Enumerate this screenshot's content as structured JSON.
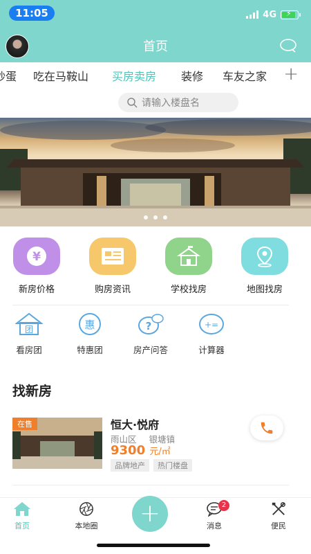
{
  "status": {
    "time": "11:05",
    "network": "4G"
  },
  "header": {
    "title": "首页"
  },
  "tabs": [
    {
      "label": "炒蛋",
      "active": false
    },
    {
      "label": "吃在马鞍山",
      "active": false
    },
    {
      "label": "买房卖房",
      "active": true
    },
    {
      "label": "装修",
      "active": false
    },
    {
      "label": "车友之家",
      "active": false
    }
  ],
  "search": {
    "placeholder": "请输入楼盘名"
  },
  "quick_actions": [
    {
      "label": "新房价格",
      "icon": "yen-icon",
      "color": "#c08fe8"
    },
    {
      "label": "购房资讯",
      "icon": "news-icon",
      "color": "#f6c76b"
    },
    {
      "label": "学校找房",
      "icon": "school-icon",
      "color": "#8fd48a"
    },
    {
      "label": "地图找房",
      "icon": "map-pin-icon",
      "color": "#7fdde0"
    }
  ],
  "sub_actions": [
    {
      "label": "看房团",
      "icon": "group-house-icon",
      "glyph": "团"
    },
    {
      "label": "特惠团",
      "icon": "discount-icon",
      "glyph": "惠"
    },
    {
      "label": "房产问答",
      "icon": "question-icon",
      "glyph": "?"
    },
    {
      "label": "计算器",
      "icon": "calculator-icon",
      "glyph": "+="
    }
  ],
  "section": {
    "title": "找新房"
  },
  "listing": {
    "badge": "在售",
    "name": "恒大·悦府",
    "district": "雨山区",
    "town": "银塘镇",
    "price": "9300",
    "unit": "元/㎡",
    "tags": [
      "品牌地产",
      "热门楼盘"
    ]
  },
  "tabbar": [
    {
      "label": "首页",
      "icon": "home-icon",
      "active": true
    },
    {
      "label": "本地圈",
      "icon": "aperture-icon",
      "active": false
    },
    {
      "label": "",
      "icon": "plus-icon",
      "active": false
    },
    {
      "label": "消息",
      "icon": "message-icon",
      "active": false,
      "badge": "2"
    },
    {
      "label": "便民",
      "icon": "tools-icon",
      "active": false
    }
  ],
  "colors": {
    "theme": "#7fd6cc",
    "accent_text": "#4fc3b7",
    "price": "#f07f2c",
    "badge": "#e8334a"
  }
}
